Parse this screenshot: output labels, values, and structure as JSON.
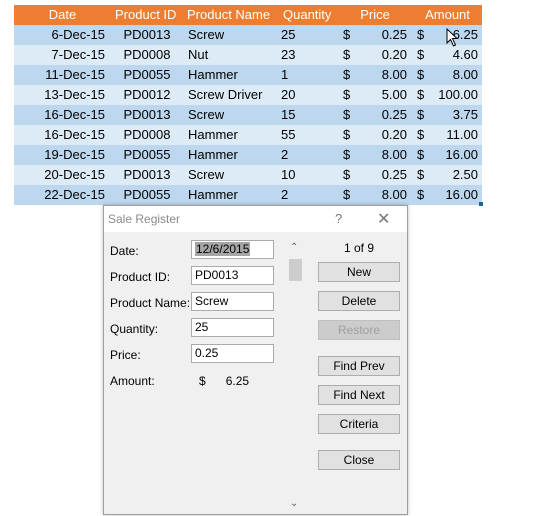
{
  "sheet": {
    "headers": {
      "date": "Date",
      "product_id": "Product ID",
      "product_name": "Product Name",
      "quantity": "Quantity",
      "price": "Price",
      "amount": "Amount"
    },
    "rows": [
      {
        "date": "6-Dec-15",
        "product_id": "PD0013",
        "product_name": "Screw",
        "quantity": "25",
        "price": "0.25",
        "amount": "6.25"
      },
      {
        "date": "7-Dec-15",
        "product_id": "PD0008",
        "product_name": "Nut",
        "quantity": "23",
        "price": "0.20",
        "amount": "4.60"
      },
      {
        "date": "11-Dec-15",
        "product_id": "PD0055",
        "product_name": "Hammer",
        "quantity": "1",
        "price": "8.00",
        "amount": "8.00"
      },
      {
        "date": "13-Dec-15",
        "product_id": "PD0012",
        "product_name": "Screw Driver",
        "quantity": "20",
        "price": "5.00",
        "amount": "100.00"
      },
      {
        "date": "16-Dec-15",
        "product_id": "PD0013",
        "product_name": "Screw",
        "quantity": "15",
        "price": "0.25",
        "amount": "3.75"
      },
      {
        "date": "16-Dec-15",
        "product_id": "PD0008",
        "product_name": "Hammer",
        "quantity": "55",
        "price": "0.20",
        "amount": "11.00"
      },
      {
        "date": "19-Dec-15",
        "product_id": "PD0055",
        "product_name": "Hammer",
        "quantity": "2",
        "price": "8.00",
        "amount": "16.00"
      },
      {
        "date": "20-Dec-15",
        "product_id": "PD0013",
        "product_name": "Screw",
        "quantity": "10",
        "price": "0.25",
        "amount": "2.50"
      },
      {
        "date": "22-Dec-15",
        "product_id": "PD0055",
        "product_name": "Hammer",
        "quantity": "2",
        "price": "8.00",
        "amount": "16.00"
      }
    ],
    "currency_symbol": "$",
    "colors": {
      "header": "#ED7D31",
      "band_dark": "#BDD7EE",
      "band_light": "#DDEBF7"
    }
  },
  "dialog": {
    "title": "Sale Register",
    "help_glyph": "?",
    "close_glyph": "✕",
    "labels": {
      "date": "Date:",
      "product_id": "Product ID:",
      "product_name": "Product Name:",
      "quantity": "Quantity:",
      "price": "Price:",
      "amount": "Amount:"
    },
    "values": {
      "date": "12/6/2015",
      "product_id": "PD0013",
      "product_name": "Screw",
      "quantity": "25",
      "price": "0.25",
      "amount_symbol": "$",
      "amount": "6.25"
    },
    "record_indicator": "1 of 9",
    "buttons": {
      "new": "New",
      "delete": "Delete",
      "restore": "Restore",
      "find_prev": "Find Prev",
      "find_next": "Find Next",
      "criteria": "Criteria",
      "close": "Close"
    },
    "scroll_up_glyph": "⌃",
    "scroll_down_glyph": "⌄"
  }
}
